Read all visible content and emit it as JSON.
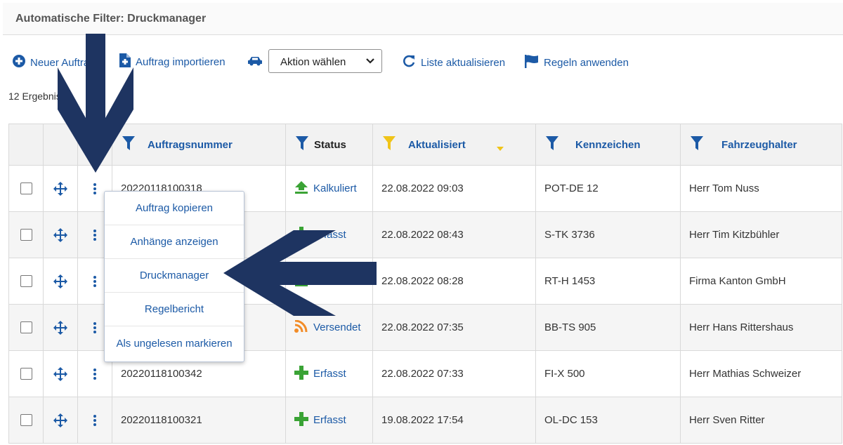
{
  "header": {
    "title": "Automatische Filter: Druckmanager"
  },
  "toolbar": {
    "new_order_label": "Neuer Auftrag",
    "import_label": "Auftrag importieren",
    "action_select_value": "Aktion wählen",
    "refresh_label": "Liste aktualisieren",
    "rules_label": "Regeln anwenden"
  },
  "results": {
    "count_text": "12 Ergebnisse"
  },
  "table": {
    "columns": [
      "Auftragsnummer",
      "Status",
      "Aktualisiert",
      "Kennzeichen",
      "Fahrzeughalter"
    ],
    "rows": [
      {
        "order": "20220118100318",
        "status": "Kalkuliert",
        "updated": "22.08.2022 09:03",
        "plate": "POT-DE 12",
        "owner": "Herr Tom Nuss"
      },
      {
        "order": "",
        "status": "Erfasst",
        "updated": "22.08.2022 08:43",
        "plate": "S-TK 3736",
        "owner": "Herr Tim Kitzbühler"
      },
      {
        "order": "",
        "status": "Kalkuliert",
        "updated": "22.08.2022 08:28",
        "plate": "RT-H 1453",
        "owner": "Firma Kanton GmbH"
      },
      {
        "order": "",
        "status": "Versendet",
        "updated": "22.08.2022 07:35",
        "plate": "BB-TS 905",
        "owner": "Herr Hans Rittershaus"
      },
      {
        "order": "20220118100342",
        "status": "Erfasst",
        "updated": "22.08.2022 07:33",
        "plate": "FI-X 500",
        "owner": "Herr Mathias Schweizer"
      },
      {
        "order": "20220118100321",
        "status": "Erfasst",
        "updated": "19.08.2022 17:54",
        "plate": "OL-DC 153",
        "owner": "Herr Sven Ritter"
      }
    ]
  },
  "context_menu": {
    "items": [
      "Auftrag kopieren",
      "Anhänge anzeigen",
      "Druckmanager",
      "Regelbericht",
      "Als ungelesen markieren"
    ]
  },
  "colors": {
    "accent": "#1c5aa6",
    "arrow": "#1e3461",
    "sort_indicator": "#f0c419"
  }
}
